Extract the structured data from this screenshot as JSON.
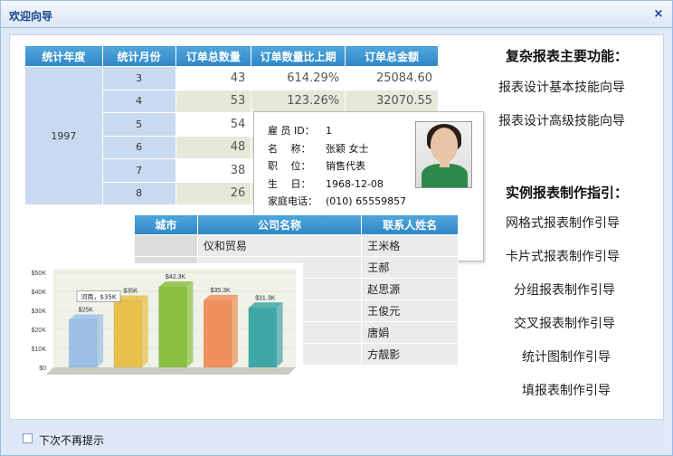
{
  "window": {
    "title": "欢迎向导",
    "close_glyph": "×"
  },
  "stats_table": {
    "headers": [
      "统计年度",
      "统计月份",
      "订单总数量",
      "订单数量比上期",
      "订单总金额"
    ],
    "year": "1997",
    "rows": [
      {
        "month": "3",
        "count": "43",
        "ratio": "614.29%",
        "amount": "25084.60"
      },
      {
        "month": "4",
        "count": "53",
        "ratio": "123.26%",
        "amount": "32070.55"
      },
      {
        "month": "5",
        "count": "54",
        "ratio": "",
        "amount": ""
      },
      {
        "month": "6",
        "count": "48",
        "ratio": "",
        "amount": ""
      },
      {
        "month": "7",
        "count": "38",
        "ratio": "",
        "amount": ""
      },
      {
        "month": "8",
        "count": "26",
        "ratio": "",
        "amount": ""
      }
    ]
  },
  "employee_card": {
    "fields": [
      {
        "label": "雇 员 ID：",
        "value": "1"
      },
      {
        "label": "名　  称：",
        "value": "张颖  女士"
      },
      {
        "label": "职　  位：",
        "value": "销售代表"
      },
      {
        "label": "生　  日：",
        "value": "1968-12-08"
      },
      {
        "label": "家庭电话：",
        "value": "(010) 65559857"
      }
    ]
  },
  "contacts_table": {
    "headers": [
      "城市",
      "公司名称",
      "联系人姓名"
    ],
    "rows": [
      {
        "city": "",
        "company": "仪和贸易",
        "contact": "王米格"
      },
      {
        "city": "",
        "company": "",
        "contact": "王郝"
      },
      {
        "city": "",
        "company": "",
        "contact": "赵思源"
      },
      {
        "city": "",
        "company": "",
        "contact": "王俊元"
      },
      {
        "city": "",
        "company": "",
        "contact": "唐娟"
      },
      {
        "city": "",
        "company": "",
        "contact": "方靓影"
      }
    ]
  },
  "chart_data": {
    "type": "bar",
    "y_ticks": [
      "$50K",
      "$40K",
      "$30K",
      "$20K",
      "$10K",
      "$0"
    ],
    "ylim": [
      0,
      50
    ],
    "values": [
      25,
      35,
      42.3,
      35.3,
      31.3
    ],
    "data_labels": [
      "$25K",
      "$35K",
      "$42.3K",
      "$35.3K",
      "$31.3K"
    ],
    "colors": [
      "#9cc0e8",
      "#e8c04c",
      "#8cc040",
      "#f0905c",
      "#3ea8a8"
    ],
    "tooltip": "河南，$35K"
  },
  "side": {
    "features_heading": "复杂报表主要功能：",
    "feature_links": [
      "报表设计基本技能向导",
      "报表设计高级技能向导"
    ],
    "examples_heading": "实例报表制作指引：",
    "example_links": [
      "网格式报表制作引导",
      "卡片式报表制作引导",
      "分组报表制作引导",
      "交叉报表制作引导",
      "统计图制作引导",
      "填报表制作引导"
    ]
  },
  "footer": {
    "checkbox_label": "下次不再提示",
    "checked": false
  }
}
